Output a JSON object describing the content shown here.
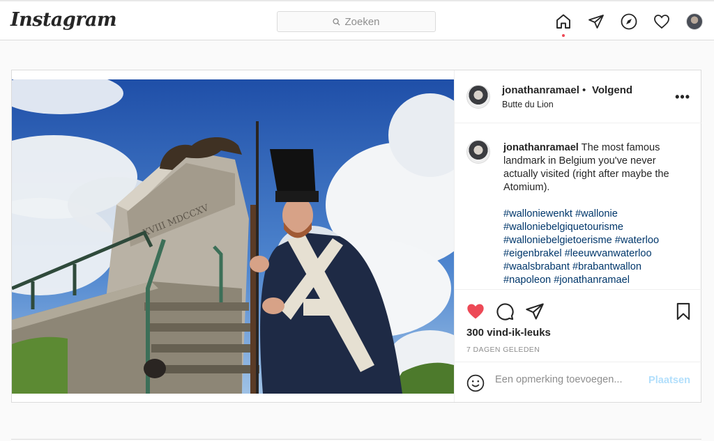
{
  "app": {
    "logo": "Instagram"
  },
  "search": {
    "placeholder": "Zoeken"
  },
  "nav": {
    "icons": [
      "home-icon",
      "direct-icon",
      "explore-icon",
      "activity-heart-icon",
      "profile-avatar"
    ]
  },
  "post": {
    "username": "jonathanramael",
    "separator": "•",
    "follow_label": "Volgend",
    "location": "Butte du Lion",
    "more": "•••",
    "caption": {
      "username": "jonathanramael",
      "text": "The most famous landmark in Belgium you've never actually visited (right after maybe the Atomium).",
      "hashtag_lines": [
        "#walloniewenkt #wallonie",
        "#walloniebelgiquetourisme",
        "#walloniebelgietoerisme #waterloo",
        "#eigenbrakel #leeuwvanwaterloo",
        "#waalsbrabant #brabantwallon",
        "#napoleon #jonathanramael"
      ]
    },
    "liked": true,
    "likes": "300 vind-ik-leuks",
    "time": "7 DAGEN GELEDEN",
    "comment_placeholder": "Een opmerking toevoegen...",
    "post_button": "Plaatsen"
  },
  "colors": {
    "like": "#ed4956",
    "link": "#00376b",
    "post_disabled": "#b2dffc"
  }
}
